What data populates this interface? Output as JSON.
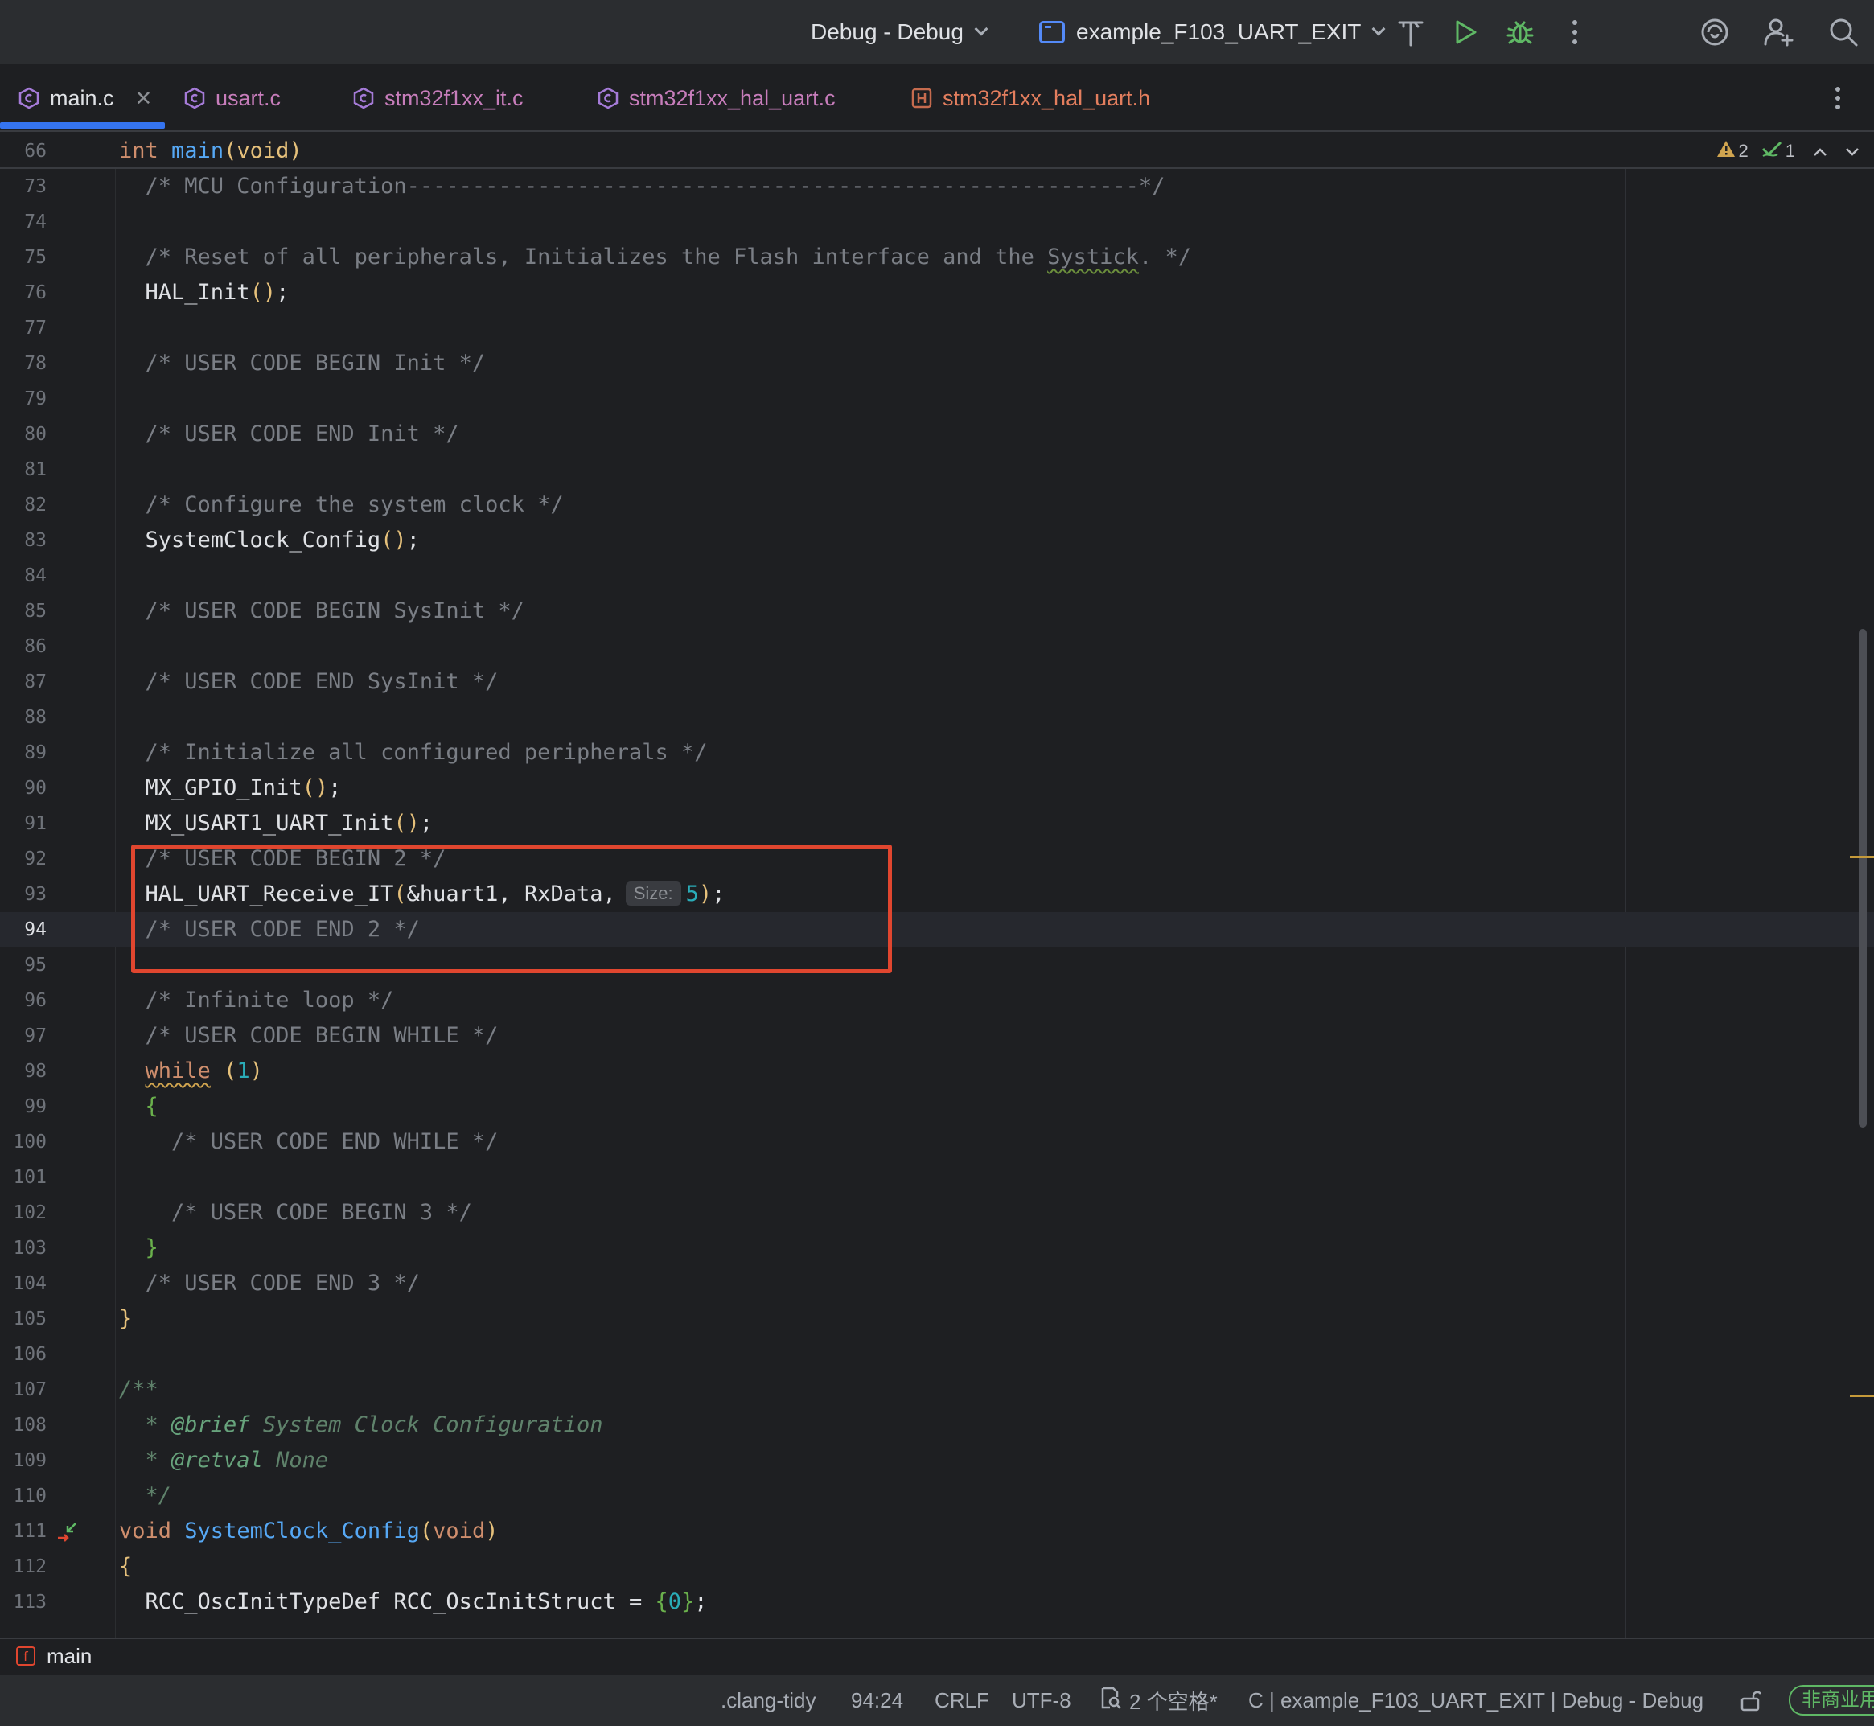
{
  "toolbar": {
    "run_config": "Debug - Debug",
    "project": "example_F103_UART_EXIT",
    "icons": [
      "build-hammer-icon",
      "run-icon",
      "debug-bug-icon",
      "more-vertical-icon",
      "ai-assistant-icon",
      "add-user-icon",
      "search-icon"
    ]
  },
  "tabs": [
    {
      "label": "main.c",
      "kind": "C",
      "active": true
    },
    {
      "label": "usart.c",
      "kind": "C"
    },
    {
      "label": "stm32f1xx_it.c",
      "kind": "C"
    },
    {
      "label": "stm32f1xx_hal_uart.c",
      "kind": "C"
    },
    {
      "label": "stm32f1xx_hal_uart.h",
      "kind": "H"
    }
  ],
  "sticky": {
    "line": "66",
    "text_kw": "int",
    "text_fn": "main",
    "text_args": "(void)"
  },
  "inspections": {
    "warnings": "2",
    "ok": "1"
  },
  "lines": [
    {
      "n": "73",
      "tokens": [
        [
          "cmt",
          "  /* MCU Configuration--------------------------------------------------------*/"
        ]
      ]
    },
    {
      "n": "74",
      "tokens": []
    },
    {
      "n": "75",
      "tokens": [
        [
          "cmt",
          "  /* Reset of all peripherals, Initializes the Flash interface and the "
        ],
        [
          "cmt squig",
          "Systick"
        ],
        [
          "cmt",
          ". */"
        ]
      ]
    },
    {
      "n": "76",
      "tokens": [
        [
          "plain",
          "  HAL_Init"
        ],
        [
          "paren",
          "()"
        ],
        [
          "plain",
          ";"
        ]
      ]
    },
    {
      "n": "77",
      "tokens": []
    },
    {
      "n": "78",
      "tokens": [
        [
          "cmt",
          "  /* USER CODE BEGIN Init */"
        ]
      ]
    },
    {
      "n": "79",
      "tokens": []
    },
    {
      "n": "80",
      "tokens": [
        [
          "cmt",
          "  /* USER CODE END Init */"
        ]
      ]
    },
    {
      "n": "81",
      "tokens": []
    },
    {
      "n": "82",
      "tokens": [
        [
          "cmt",
          "  /* Configure the system clock */"
        ]
      ]
    },
    {
      "n": "83",
      "tokens": [
        [
          "plain",
          "  SystemClock_Config"
        ],
        [
          "paren",
          "()"
        ],
        [
          "plain",
          ";"
        ]
      ]
    },
    {
      "n": "84",
      "tokens": []
    },
    {
      "n": "85",
      "tokens": [
        [
          "cmt",
          "  /* USER CODE BEGIN SysInit */"
        ]
      ]
    },
    {
      "n": "86",
      "tokens": []
    },
    {
      "n": "87",
      "tokens": [
        [
          "cmt",
          "  /* USER CODE END SysInit */"
        ]
      ]
    },
    {
      "n": "88",
      "tokens": []
    },
    {
      "n": "89",
      "tokens": [
        [
          "cmt",
          "  /* Initialize all configured peripherals */"
        ]
      ]
    },
    {
      "n": "90",
      "tokens": [
        [
          "plain",
          "  MX_GPIO_Init"
        ],
        [
          "paren",
          "()"
        ],
        [
          "plain",
          ";"
        ]
      ]
    },
    {
      "n": "91",
      "tokens": [
        [
          "plain",
          "  MX_USART1_UART_Init"
        ],
        [
          "paren",
          "()"
        ],
        [
          "plain",
          ";"
        ]
      ]
    },
    {
      "n": "92",
      "tokens": [
        [
          "cmt",
          "  /* USER CODE BEGIN 2 */"
        ]
      ]
    },
    {
      "n": "93",
      "tokens": [
        [
          "plain",
          "  HAL_UART_Receive_IT"
        ],
        [
          "paren",
          "("
        ],
        [
          "plain",
          "&huart1, RxData,"
        ],
        [
          "hint",
          "Size:"
        ],
        [
          "num",
          "5"
        ],
        [
          "paren",
          ")"
        ],
        [
          "plain",
          ";"
        ]
      ]
    },
    {
      "n": "94",
      "current": true,
      "tokens": [
        [
          "cmt",
          "  /* USER CODE END 2 */"
        ]
      ]
    },
    {
      "n": "95",
      "tokens": []
    },
    {
      "n": "96",
      "tokens": [
        [
          "cmt",
          "  /* Infinite loop */"
        ]
      ]
    },
    {
      "n": "97",
      "tokens": [
        [
          "cmt",
          "  /* USER CODE BEGIN WHILE */"
        ]
      ]
    },
    {
      "n": "98",
      "tokens": [
        [
          "plain",
          "  "
        ],
        [
          "kw squig-red",
          "while"
        ],
        [
          "plain",
          " "
        ],
        [
          "paren",
          "("
        ],
        [
          "num",
          "1"
        ],
        [
          "paren",
          ")"
        ]
      ]
    },
    {
      "n": "99",
      "tokens": [
        [
          "plain",
          "  "
        ],
        [
          "brace",
          "{"
        ]
      ]
    },
    {
      "n": "100",
      "tokens": [
        [
          "cmt",
          "    /* USER CODE END WHILE */"
        ]
      ]
    },
    {
      "n": "101",
      "tokens": []
    },
    {
      "n": "102",
      "tokens": [
        [
          "cmt",
          "    /* USER CODE BEGIN 3 */"
        ]
      ]
    },
    {
      "n": "103",
      "tokens": [
        [
          "plain",
          "  "
        ],
        [
          "brace",
          "}"
        ]
      ]
    },
    {
      "n": "104",
      "tokens": [
        [
          "cmt",
          "  /* USER CODE END 3 */"
        ]
      ]
    },
    {
      "n": "105",
      "tokens": [
        [
          "paren",
          "}"
        ]
      ]
    },
    {
      "n": "106",
      "tokens": []
    },
    {
      "n": "107",
      "tokens": [
        [
          "doc",
          "/**"
        ]
      ]
    },
    {
      "n": "108",
      "tokens": [
        [
          "doc",
          "  * "
        ],
        [
          "doctag",
          "@brief"
        ],
        [
          "doc",
          " System Clock Configuration"
        ]
      ]
    },
    {
      "n": "109",
      "tokens": [
        [
          "doc",
          "  * "
        ],
        [
          "doctag",
          "@retval"
        ],
        [
          "doc",
          " None"
        ]
      ]
    },
    {
      "n": "110",
      "tokens": [
        [
          "doc",
          "  */"
        ]
      ]
    },
    {
      "n": "111",
      "gutter_icon": "override-navigation-icon",
      "tokens": [
        [
          "kw",
          "void"
        ],
        [
          "plain",
          " "
        ],
        [
          "fn",
          "SystemClock_Config"
        ],
        [
          "paren",
          "("
        ],
        [
          "kw",
          "void"
        ],
        [
          "paren",
          ")"
        ]
      ]
    },
    {
      "n": "112",
      "tokens": [
        [
          "paren",
          "{"
        ]
      ]
    },
    {
      "n": "113",
      "tokens": [
        [
          "plain",
          "  RCC_OscInitTypeDef RCC_OscInitStruct = "
        ],
        [
          "brace",
          "{"
        ],
        [
          "num",
          "0"
        ],
        [
          "brace",
          "}"
        ],
        [
          "plain",
          ";"
        ]
      ]
    }
  ],
  "breadcrumb": {
    "label": "main",
    "icon": "function-icon"
  },
  "status": {
    "linter": ".clang-tidy",
    "position": "94:24",
    "line_ending": "CRLF",
    "encoding": "UTF-8",
    "indent": "2 个空格*",
    "context": "C | example_F103_UART_EXIT | Debug - Debug",
    "license": "非商业用"
  },
  "colors": {
    "accent": "#3574f0",
    "highlight_box": "#e0462f",
    "warning": "#d0a44f",
    "run_green": "#5fb865"
  }
}
